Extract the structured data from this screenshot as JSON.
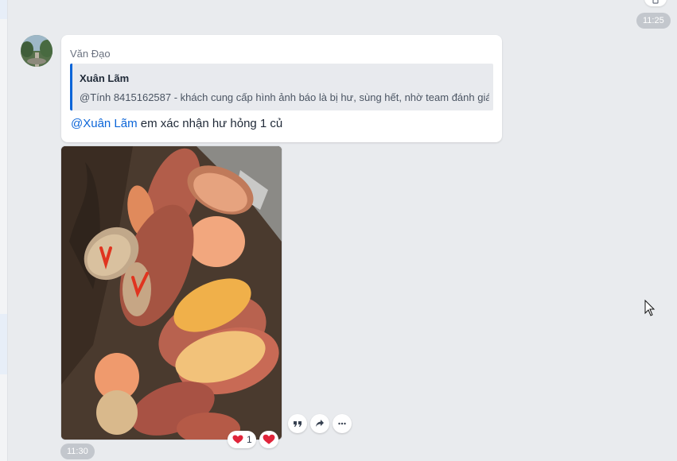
{
  "previous_message": {
    "time": "11:25"
  },
  "message": {
    "sender": "Văn Đạo",
    "quote": {
      "author": "Xuân Lãm",
      "text": "@Tính 8415162587 - khách cung cấp hình ảnh báo là bị hư, sùng hết, nhờ team đánh giá"
    },
    "mention": "@Xuân Lãm",
    "text": " em xác nhận hư hỏng 1 củ"
  },
  "photo_message": {
    "time": "11:30",
    "reaction": {
      "icon": "heart-icon",
      "count": "1"
    },
    "actions": [
      "quote-icon",
      "share-icon",
      "more-icon"
    ]
  },
  "colors": {
    "mention": "#0b65d8",
    "quote_bar": "#0b65d8",
    "heart": "#e0243a",
    "background": "#e9ebee"
  }
}
